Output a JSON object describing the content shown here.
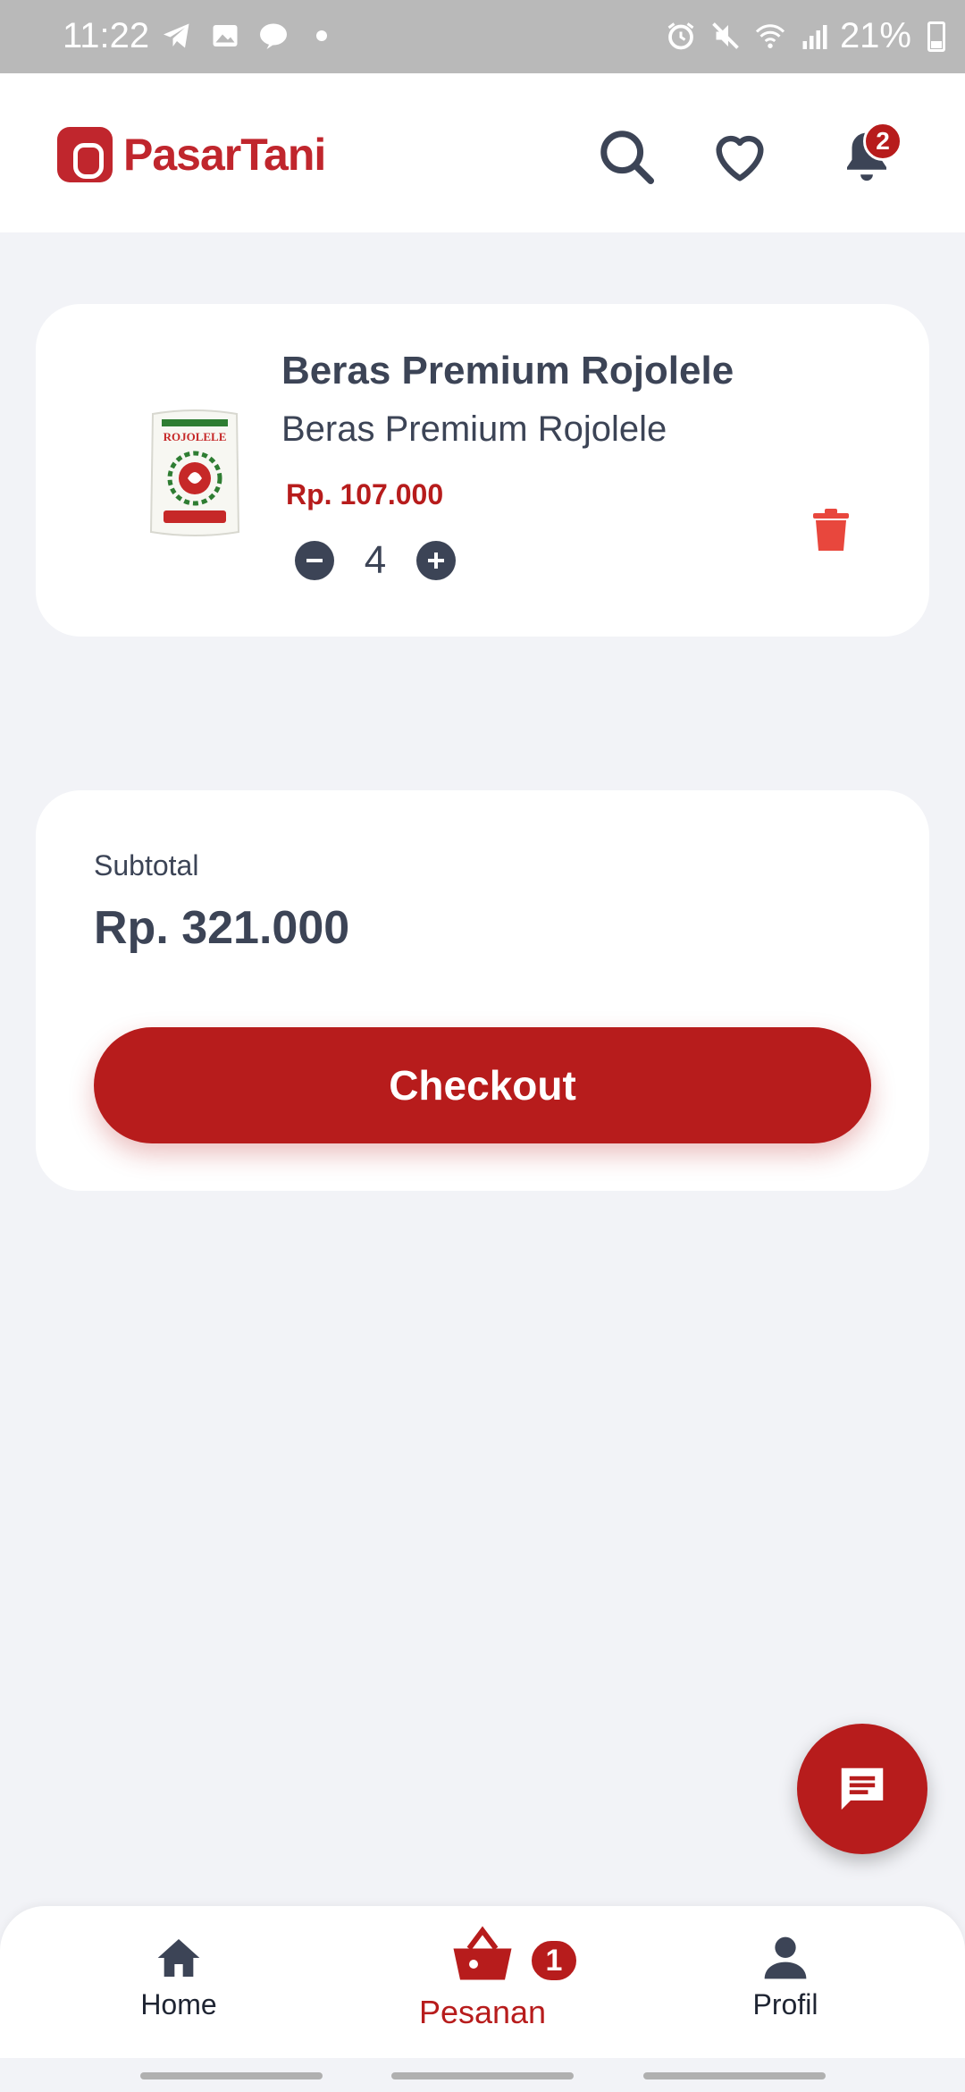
{
  "status_bar": {
    "time": "11:22",
    "battery": "21%",
    "left_icons": [
      "telegram-icon",
      "gallery-icon",
      "line-icon",
      "dot-icon"
    ],
    "right_icons": [
      "alarm-icon",
      "mute-icon",
      "wifi-icon",
      "signal-icon"
    ]
  },
  "header": {
    "brand": "PasarTani",
    "notification_count": "2"
  },
  "cart": {
    "items": [
      {
        "title": "Beras Premium Rojolele",
        "subtitle": "Beras Premium Rojolele",
        "price": "Rp. 107.000",
        "quantity": "4",
        "image_label": "ROJOLELE"
      }
    ]
  },
  "summary": {
    "subtotal_label": "Subtotal",
    "subtotal_value": "Rp. 321.000",
    "checkout_label": "Checkout"
  },
  "bottom_nav": {
    "items": [
      {
        "label": "Home",
        "icon": "home-icon"
      },
      {
        "label": "Pesanan",
        "icon": "basket-icon",
        "badge": "1",
        "active": true
      },
      {
        "label": "Profil",
        "icon": "person-icon"
      }
    ]
  },
  "colors": {
    "accent": "#b71c1c",
    "text": "#3c4456",
    "background": "#f2f3f7",
    "status_bar": "#b9b9b9"
  }
}
